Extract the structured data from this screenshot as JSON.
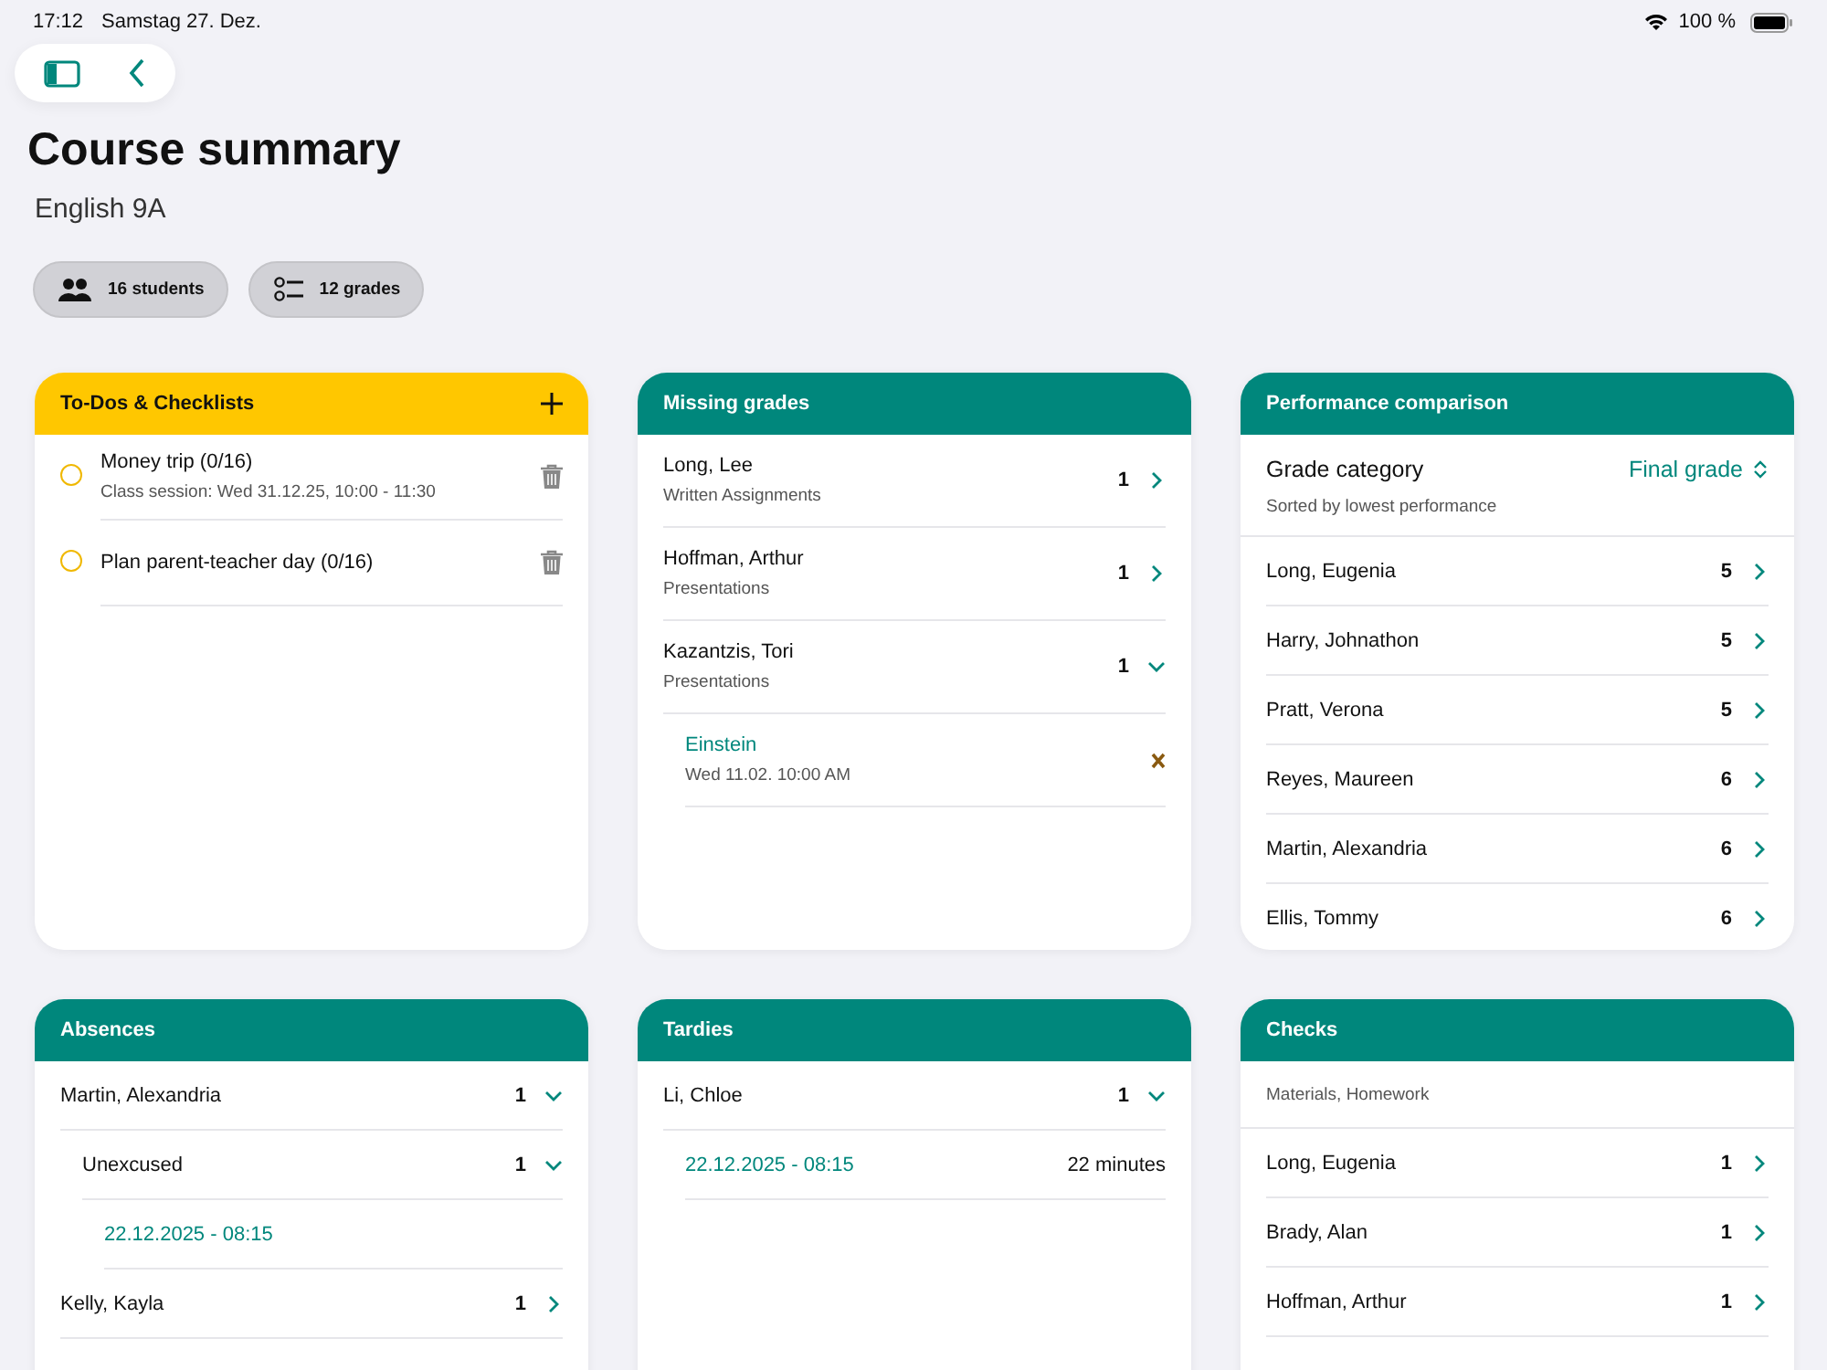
{
  "status_bar": {
    "time": "17:12",
    "date": "Samstag 27. Dez.",
    "battery": "100 %"
  },
  "title": "Course summary",
  "subtitle": "English 9A",
  "chips": [
    {
      "kind": "students",
      "label": "16 students"
    },
    {
      "kind": "grades",
      "label": "12 grades"
    }
  ],
  "todos": {
    "title": "To-Dos & Checklists",
    "items": [
      {
        "title": "Money trip (0/16)",
        "detail": "Class session: Wed 31.12.25, 10:00 - 11:30",
        "done": false
      },
      {
        "title": "Plan parent-teacher day (0/16)",
        "done": false
      }
    ]
  },
  "missing_grades": {
    "title": "Missing grades",
    "rows": [
      {
        "name": "Long, Lee",
        "category": "Written Assignments",
        "count": "1",
        "expanded": false
      },
      {
        "name": "Hoffman, Arthur",
        "category": "Presentations",
        "count": "1",
        "expanded": false
      },
      {
        "name": "Kazantzis, Tori",
        "category": "Presentations",
        "count": "1",
        "expanded": true,
        "children": [
          {
            "title": "Einstein",
            "time": "Wed 11.02. 10:00 AM"
          }
        ]
      }
    ]
  },
  "performance": {
    "title": "Performance comparison",
    "category_label": "Grade category",
    "category_value": "Final grade",
    "note": "Sorted by lowest performance",
    "rows": [
      {
        "name": "Long, Eugenia",
        "grade": "5"
      },
      {
        "name": "Harry, Johnathon",
        "grade": "5"
      },
      {
        "name": "Pratt, Verona",
        "grade": "5"
      },
      {
        "name": "Reyes, Maureen",
        "grade": "6"
      },
      {
        "name": "Martin, Alexandria",
        "grade": "6"
      },
      {
        "name": "Ellis, Tommy",
        "grade": "6"
      }
    ]
  },
  "absences": {
    "title": "Absences",
    "rows": [
      {
        "name": "Martin, Alexandria",
        "count": "1",
        "expanded": true,
        "children": [
          {
            "name": "Unexcused",
            "count": "1",
            "expanded": true,
            "children": [
              {
                "date": "22.12.2025 - 08:15"
              }
            ]
          }
        ]
      },
      {
        "name": "Kelly, Kayla",
        "count": "1",
        "expanded": false
      }
    ]
  },
  "tardies": {
    "title": "Tardies",
    "rows": [
      {
        "name": "Li, Chloe",
        "count": "1",
        "expanded": true,
        "children": [
          {
            "date": "22.12.2025 - 08:15",
            "duration": "22 minutes"
          }
        ]
      }
    ]
  },
  "checks": {
    "title": "Checks",
    "note": "Materials, Homework",
    "rows": [
      {
        "name": "Long, Eugenia",
        "count": "1"
      },
      {
        "name": "Brady, Alan",
        "count": "1"
      },
      {
        "name": "Hoffman, Arthur",
        "count": "1"
      }
    ]
  }
}
